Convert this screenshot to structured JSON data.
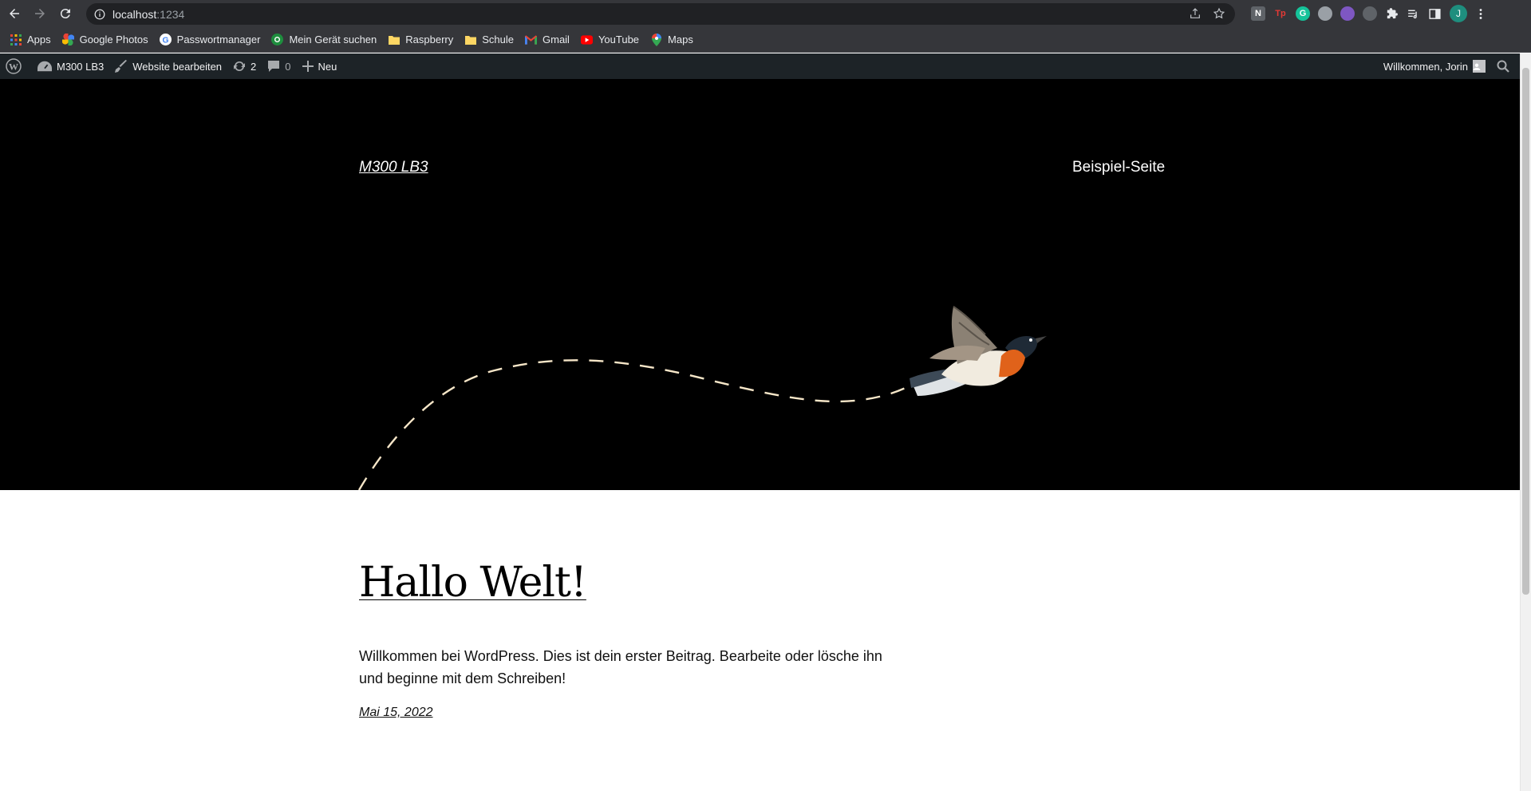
{
  "browser": {
    "url_host": "localhost",
    "url_port": ":1234",
    "profile_initial": "J",
    "bookmarks": [
      {
        "label": "Apps",
        "icon": "apps-grid-icon"
      },
      {
        "label": "Google Photos",
        "icon": "google-photos-icon"
      },
      {
        "label": "Passwortmanager",
        "icon": "google-icon"
      },
      {
        "label": "Mein Gerät suchen",
        "icon": "find-device-icon"
      },
      {
        "label": "Raspberry",
        "icon": "folder-icon"
      },
      {
        "label": "Schule",
        "icon": "folder-icon"
      },
      {
        "label": "Gmail",
        "icon": "gmail-icon"
      },
      {
        "label": "YouTube",
        "icon": "youtube-icon"
      },
      {
        "label": "Maps",
        "icon": "maps-icon"
      }
    ]
  },
  "adminbar": {
    "site_name": "M300 LB3",
    "edit_site": "Website bearbeiten",
    "updates_count": "2",
    "comments_count": "0",
    "new_label": "Neu",
    "greeting": "Willkommen, Jorin"
  },
  "site": {
    "title": "M300 LB3",
    "menu_item": "Beispiel-Seite"
  },
  "post": {
    "title": "Hallo Welt!",
    "excerpt": "Willkommen bei WordPress. Dies ist dein erster Beitrag. Bearbeite oder lösche ihn und beginne mit dem Schreiben!",
    "date": "Mai 15, 2022"
  },
  "colors": {
    "chrome_bg": "#35363a",
    "omnibox_bg": "#202124",
    "adminbar_bg": "#1d2327",
    "hero_bg": "#000000",
    "dash_color": "#f6e6c8"
  }
}
